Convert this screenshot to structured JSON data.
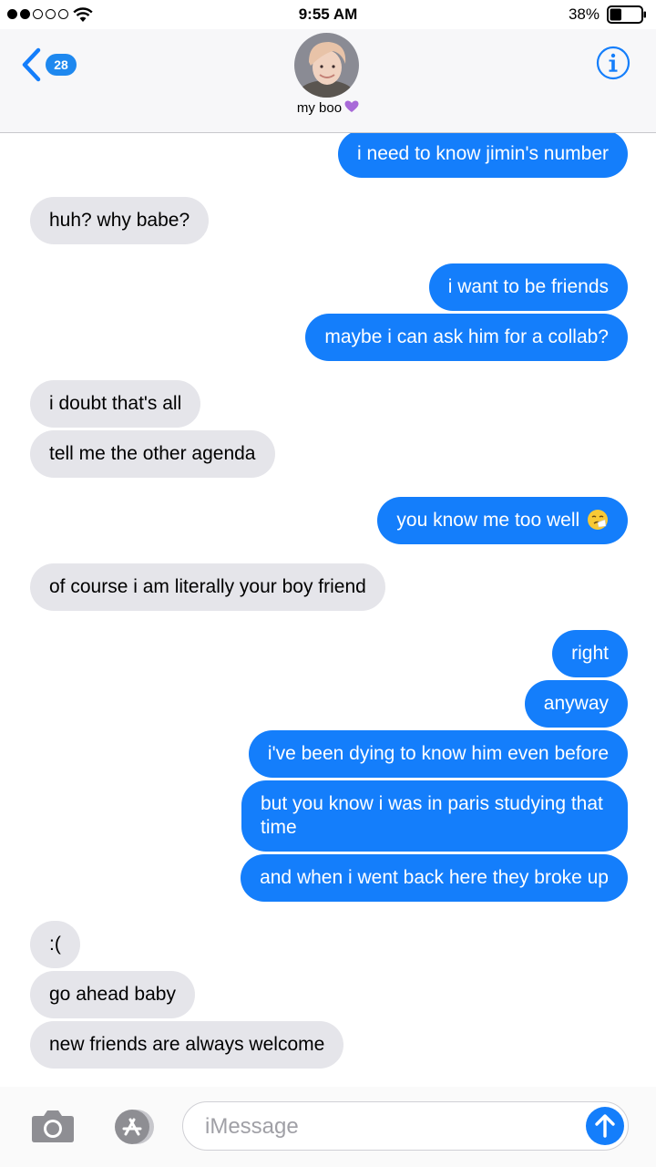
{
  "status": {
    "time": "9:55 AM",
    "battery_percent": "38%",
    "battery_level": 0.38,
    "signal_bars_filled": 2,
    "signal_bars_total": 5
  },
  "header": {
    "back_badge": "28",
    "contact_name": "my boo",
    "contact_emoji": "purple-heart-icon",
    "accent_color": "#147efb"
  },
  "messages": [
    {
      "dir": "out",
      "text": "i need to know jimin's number"
    },
    {
      "dir": "in",
      "text": "huh? why babe?"
    },
    {
      "dir": "out",
      "text": "i want to be friends"
    },
    {
      "dir": "out",
      "text": "maybe i can ask him for a collab?"
    },
    {
      "dir": "in",
      "text": "i doubt that's all"
    },
    {
      "dir": "in",
      "text": "tell me the other agenda"
    },
    {
      "dir": "out",
      "text": "you know me too well",
      "emoji": "sneezing-face-icon"
    },
    {
      "dir": "in",
      "text": "of course i am literally your boy friend"
    },
    {
      "dir": "out",
      "text": "right"
    },
    {
      "dir": "out",
      "text": "anyway"
    },
    {
      "dir": "out",
      "text": "i've been dying to know him even before"
    },
    {
      "dir": "out",
      "text": "but you know i was in paris studying that time"
    },
    {
      "dir": "out",
      "text": "and when i went back here they broke up"
    },
    {
      "dir": "in",
      "text": ":("
    },
    {
      "dir": "in",
      "text": "go ahead baby"
    },
    {
      "dir": "in",
      "text": "new friends are always welcome"
    }
  ],
  "input": {
    "placeholder": "iMessage"
  },
  "colors": {
    "outgoing_bubble": "#147efb",
    "incoming_bubble": "#e5e5ea"
  }
}
